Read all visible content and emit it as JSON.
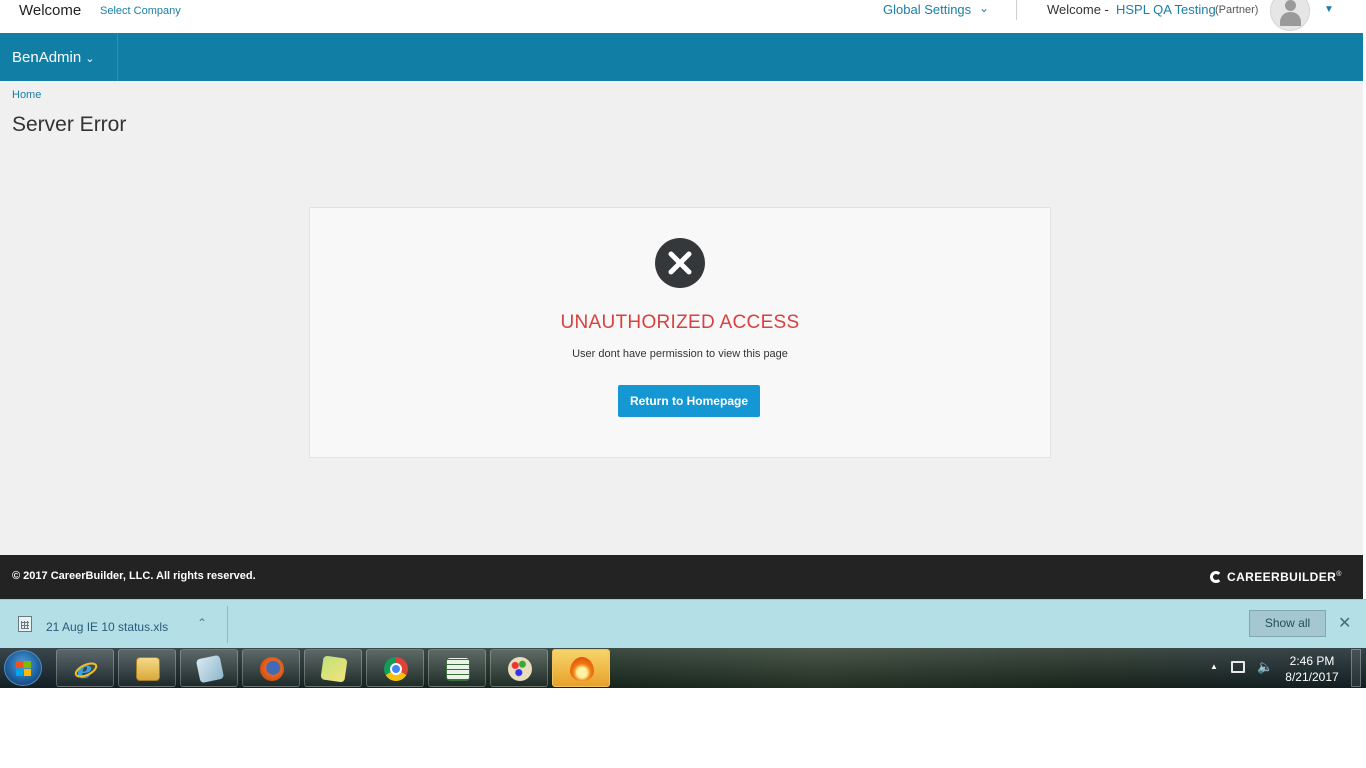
{
  "header": {
    "welcome_label": "Welcome",
    "select_company_label": "Select Company",
    "global_settings_label": "Global Settings",
    "user_welcome_label": "Welcome -",
    "user_name": "HSPL QA Testing",
    "user_role": "(Partner)",
    "avatar_icon": "user-avatar-icon"
  },
  "nav": {
    "app_menu_label": "BenAdmin"
  },
  "breadcrumb": {
    "home_label": "Home"
  },
  "page": {
    "title": "Server Error"
  },
  "error": {
    "icon": "close-circle-icon",
    "title": "UNAUTHORIZED ACCESS",
    "message": "User dont have permission to view this page",
    "button_label": "Return to Homepage",
    "colors": {
      "title": "#d9403f",
      "button": "#1497d3"
    }
  },
  "footer": {
    "copyright": "© 2017 CareerBuilder, LLC. All rights reserved.",
    "logo_text": "CAREERBUILDER",
    "logo_suffix": "®"
  },
  "download_bar": {
    "file_name": "21 Aug IE 10 status.xls",
    "show_all_label": "Show all"
  },
  "taskbar": {
    "apps": [
      {
        "name": "internet-explorer-icon"
      },
      {
        "name": "file-explorer-icon"
      },
      {
        "name": "notepad-icon"
      },
      {
        "name": "firefox-icon"
      },
      {
        "name": "sticky-notes-icon"
      },
      {
        "name": "chrome-icon"
      },
      {
        "name": "spreadsheet-icon"
      },
      {
        "name": "paint-icon"
      },
      {
        "name": "app-flame-icon"
      }
    ],
    "clock_time": "2:46 PM",
    "clock_date": "8/21/2017"
  },
  "theme": {
    "brand_teal": "#117ea5",
    "link_blue": "#1a7ea6",
    "footer_bg": "#232323",
    "download_bar_bg": "#b5dfe7"
  }
}
